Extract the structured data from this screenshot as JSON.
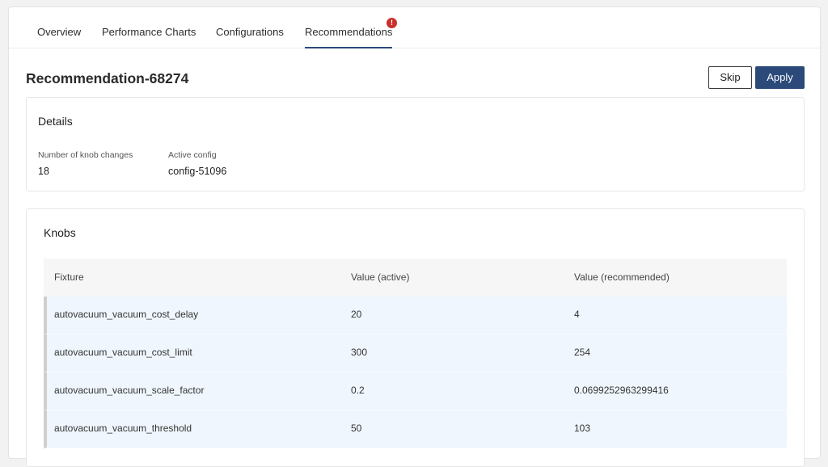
{
  "tabs": [
    {
      "label": "Overview"
    },
    {
      "label": "Performance Charts"
    },
    {
      "label": "Configurations"
    },
    {
      "label": "Recommendations",
      "active": true,
      "badge": "!"
    }
  ],
  "header": {
    "title": "Recommendation-68274",
    "skip_label": "Skip",
    "apply_label": "Apply"
  },
  "details": {
    "title": "Details",
    "knob_changes_label": "Number of knob changes",
    "knob_changes_value": "18",
    "active_config_label": "Active config",
    "active_config_value": "config-51096"
  },
  "knobs": {
    "title": "Knobs",
    "columns": [
      "Fixture",
      "Value (active)",
      "Value (recommended)"
    ],
    "rows": [
      [
        "autovacuum_vacuum_cost_delay",
        "20",
        "4"
      ],
      [
        "autovacuum_vacuum_cost_limit",
        "300",
        "254"
      ],
      [
        "autovacuum_vacuum_scale_factor",
        "0.2",
        "0.0699252963299416"
      ],
      [
        "autovacuum_vacuum_threshold",
        "50",
        "103"
      ]
    ]
  },
  "colors": {
    "accent": "#2b4a7a",
    "badge": "#c9302c",
    "row_highlight": "#eff6fd"
  }
}
